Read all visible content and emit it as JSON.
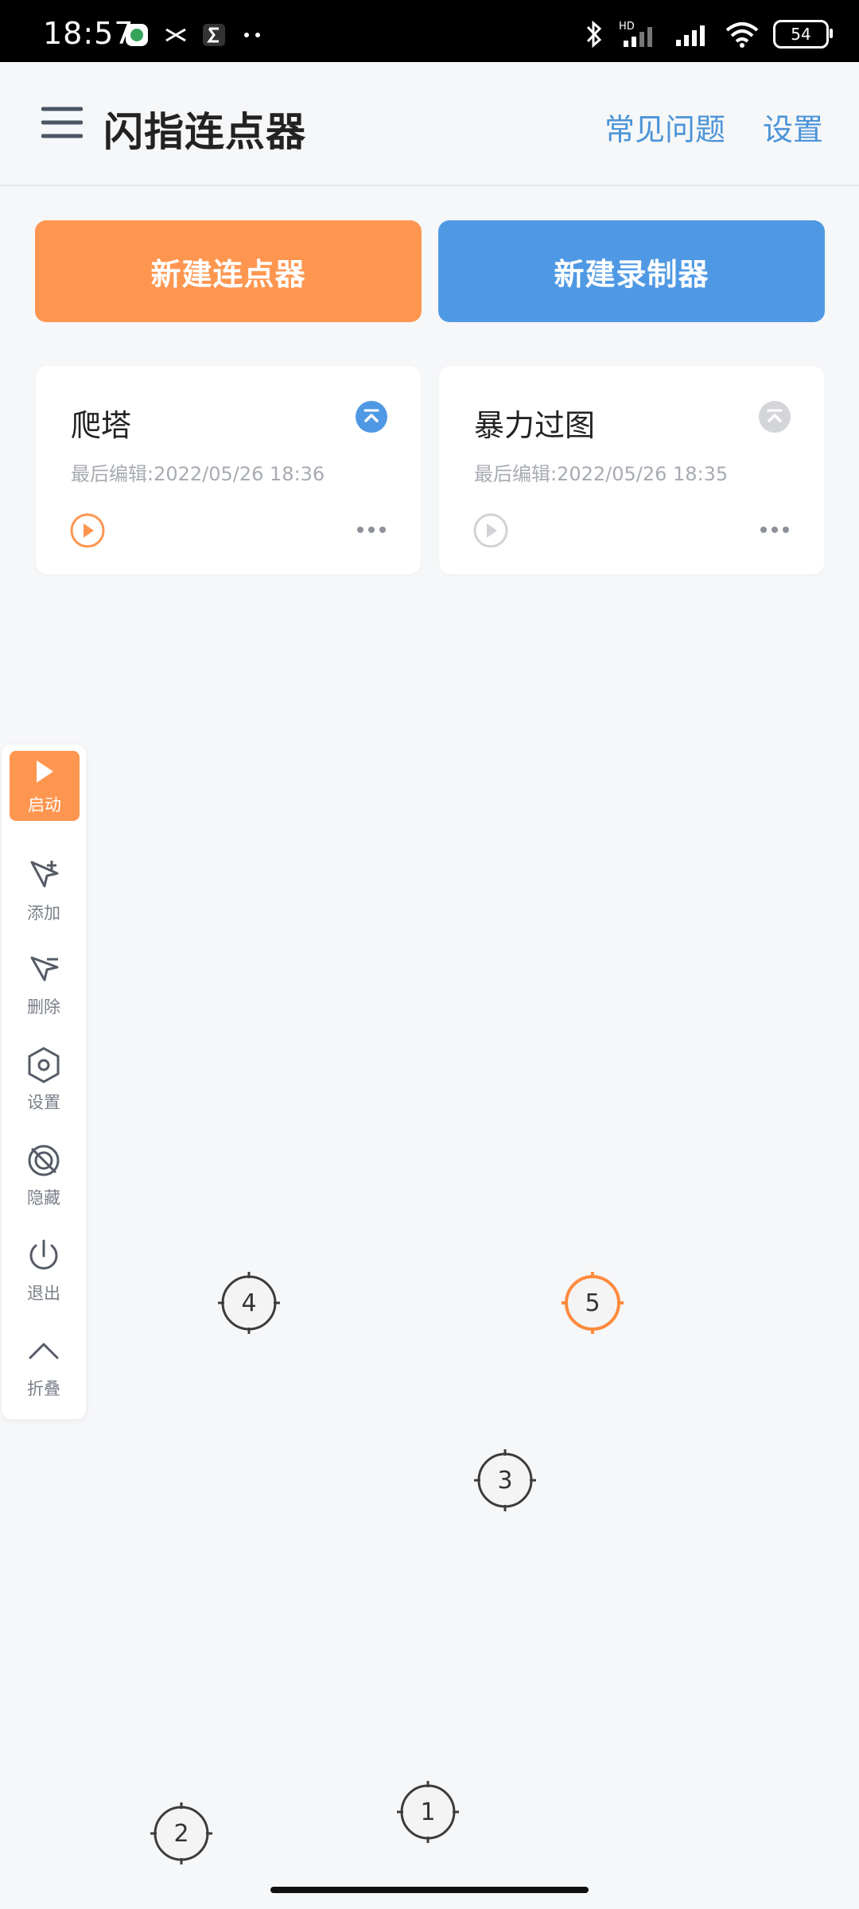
{
  "status_bar": {
    "time": "18:57",
    "battery": "54",
    "left_icons": [
      "app-icon",
      "scissors-icon",
      "sigma-icon",
      "more-dots-icon"
    ],
    "right_icons": [
      "bluetooth-icon",
      "hd-signal-icon",
      "signal-icon",
      "wifi-icon",
      "battery-icon"
    ]
  },
  "app_bar": {
    "title": "闪指连点器",
    "faq": "常见问题",
    "settings": "设置"
  },
  "actions": {
    "new_clicker": "新建连点器",
    "new_recorder": "新建录制器"
  },
  "scripts": [
    {
      "title": "爬塔",
      "meta": "最后编辑:2022/05/26 18:36",
      "active": true
    },
    {
      "title": "暴力过图",
      "meta": "最后编辑:2022/05/26 18:35",
      "active": false
    }
  ],
  "floating_panel": {
    "start": "启动",
    "add": "添加",
    "delete": "删除",
    "settings": "设置",
    "hide": "隐藏",
    "exit": "退出",
    "collapse": "折叠"
  },
  "targets": [
    {
      "number": "4"
    },
    {
      "number": "5"
    },
    {
      "number": "3"
    },
    {
      "number": "1"
    },
    {
      "number": "2"
    }
  ],
  "colors": {
    "accent_orange": "#ff9650",
    "accent_blue": "#4f99e4",
    "link_blue": "#4c94d8",
    "background": "#f6f7f9"
  }
}
